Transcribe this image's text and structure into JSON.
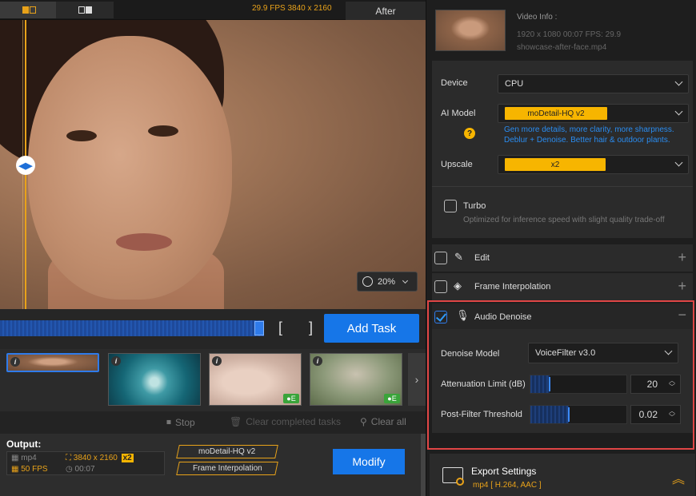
{
  "topbar": {
    "fps_resolution": "29.9 FPS  3840 x 2160",
    "after_label": "After"
  },
  "preview": {
    "zoom_value": "20%"
  },
  "timeline": {
    "add_task_label": "Add Task",
    "brackets": "[ ]"
  },
  "thumbnails": [
    {
      "info": "i",
      "badge": ""
    },
    {
      "info": "i",
      "badge": ""
    },
    {
      "info": "i",
      "badge": "E"
    },
    {
      "info": "i",
      "badge": "E"
    }
  ],
  "task_controls": {
    "stop": "Stop",
    "clear_completed": "Clear completed tasks",
    "clear_all": "Clear all"
  },
  "output": {
    "title": "Output:",
    "format": "mp4",
    "resolution": "3840 x 2160",
    "scale_badge": "x2",
    "fps": "50 FPS",
    "duration": "00:07",
    "chip_model": "moDetail-HQ  v2",
    "chip_interp": "Frame Interpolation",
    "modify_label": "Modify"
  },
  "video_info": {
    "title": "Video Info :",
    "meta": "1920 x 1080  00:07    FPS: 29.9",
    "filename": "showcase-after-face.mp4"
  },
  "settings": {
    "device_label": "Device",
    "device_value": "CPU",
    "model_label": "AI Model",
    "model_value": "moDetail-HQ  v2",
    "model_desc_1": "Gen more details, more clarity, more sharpness.",
    "model_desc_2": "Deblur + Denoise. Better hair & outdoor plants.",
    "help": "?",
    "upscale_label": "Upscale",
    "upscale_value": "x2",
    "turbo_label": "Turbo",
    "turbo_desc": "Optimized for inference speed with slight quality trade-off"
  },
  "sections": {
    "edit": "Edit",
    "frame_interp": "Frame Interpolation",
    "audio_denoise": "Audio Denoise"
  },
  "denoise": {
    "model_label": "Denoise Model",
    "model_value": "VoiceFilter v3.0",
    "atten_label": "Attenuation Limit (dB)",
    "atten_value": "20",
    "atten_level": 0.2,
    "post_label": "Post-Filter Threshold",
    "post_value": "0.02",
    "post_level": 0.4
  },
  "export": {
    "title": "Export Settings",
    "sub": "mp4 [ H.264, AAC ]"
  },
  "colors": {
    "accent_blue": "#1676e8",
    "accent_orange": "#e8a21a",
    "highlight_red": "#e04545"
  }
}
